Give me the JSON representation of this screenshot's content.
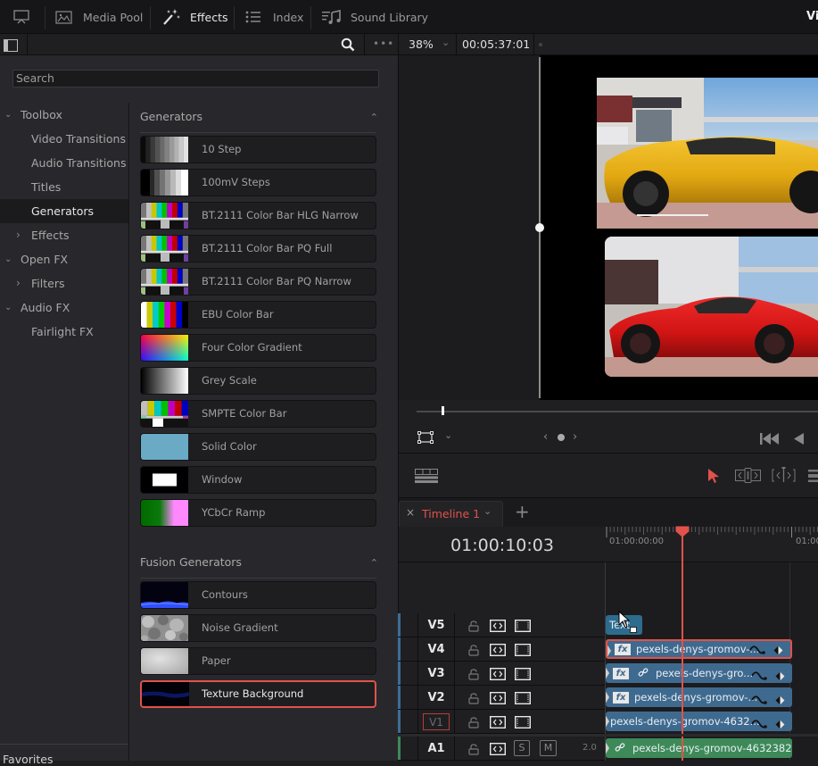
{
  "topbar": {
    "tabs": [
      {
        "label": "Media Pool",
        "icon": "media-pool-icon"
      },
      {
        "label": "Effects",
        "icon": "magic-wand-icon",
        "active": true
      },
      {
        "label": "Index",
        "icon": "list-icon"
      },
      {
        "label": "Sound Library",
        "icon": "music-icon"
      }
    ],
    "right_title_partial": "Vi"
  },
  "effects_panel": {
    "search_placeholder": "Search",
    "tree": [
      {
        "label": "Toolbox",
        "expanded": true,
        "level": 0
      },
      {
        "label": "Video Transitions",
        "level": 1
      },
      {
        "label": "Audio Transitions",
        "level": 1
      },
      {
        "label": "Titles",
        "level": 1
      },
      {
        "label": "Generators",
        "level": 1,
        "selected": true
      },
      {
        "label": "Effects",
        "level": 1,
        "collapsed": true
      },
      {
        "label": "Open FX",
        "expanded": true,
        "level": 0
      },
      {
        "label": "Filters",
        "level": 1,
        "collapsed": true
      },
      {
        "label": "Audio FX",
        "expanded": true,
        "level": 0
      },
      {
        "label": "Fairlight FX",
        "level": 1
      }
    ],
    "favorites_label": "Favorites",
    "sections": [
      {
        "title": "Generators",
        "items": [
          {
            "label": "10 Step",
            "thumb": "steps10"
          },
          {
            "label": "100mV Steps",
            "thumb": "steps100"
          },
          {
            "label": "BT.2111 Color Bar HLG Narrow",
            "thumb": "bt2111"
          },
          {
            "label": "BT.2111 Color Bar PQ Full",
            "thumb": "bt2111"
          },
          {
            "label": "BT.2111 Color Bar PQ Narrow",
            "thumb": "bt2111"
          },
          {
            "label": "EBU Color Bar",
            "thumb": "ebu"
          },
          {
            "label": "Four Color Gradient",
            "thumb": "fourcolor"
          },
          {
            "label": "Grey Scale",
            "thumb": "grey"
          },
          {
            "label": "SMPTE Color Bar",
            "thumb": "smpte"
          },
          {
            "label": "Solid Color",
            "thumb": "solid",
            "color": "#6aaac4"
          },
          {
            "label": "Window",
            "thumb": "window"
          },
          {
            "label": "YCbCr Ramp",
            "thumb": "ycbcr"
          }
        ]
      },
      {
        "title": "Fusion Generators",
        "items": [
          {
            "label": "Contours",
            "thumb": "contours"
          },
          {
            "label": "Noise Gradient",
            "thumb": "noise"
          },
          {
            "label": "Paper",
            "thumb": "paper"
          },
          {
            "label": "Texture Background",
            "thumb": "texture",
            "selected": true
          }
        ]
      }
    ]
  },
  "viewer": {
    "zoom": "38%",
    "timecode": "00:05:37:01"
  },
  "timeline": {
    "tab_label": "Timeline 1",
    "current_timecode": "01:00:10:03",
    "ruler_labels": [
      "01:00:00:00",
      "01:00"
    ],
    "tracks": [
      {
        "name": "V5",
        "type": "video",
        "clip": {
          "label": "Text",
          "kind": "title"
        }
      },
      {
        "name": "V4",
        "type": "video",
        "clip": {
          "label": "pexels-denys-gromov-...",
          "fx": true,
          "selected": true
        }
      },
      {
        "name": "V3",
        "type": "video",
        "clip": {
          "label": "pexels-denys-gro...",
          "fx": true,
          "linked": true
        }
      },
      {
        "name": "V2",
        "type": "video",
        "clip": {
          "label": "pexels-denys-gromov-...",
          "fx": true
        }
      },
      {
        "name": "V1",
        "type": "video",
        "dim": true,
        "clip": {
          "label": "pexels-denys-gromov-4632..."
        }
      },
      {
        "name": "A1",
        "type": "audio",
        "level": "2.0",
        "solo": "S",
        "mute": "M",
        "clip": {
          "label": "pexels-denys-gromov-4632382-...",
          "linked": true
        }
      }
    ]
  },
  "colors": {
    "accent_red": "#e0524a",
    "video_clip": "#3f6a8f",
    "audio_clip": "#3d8a58"
  }
}
